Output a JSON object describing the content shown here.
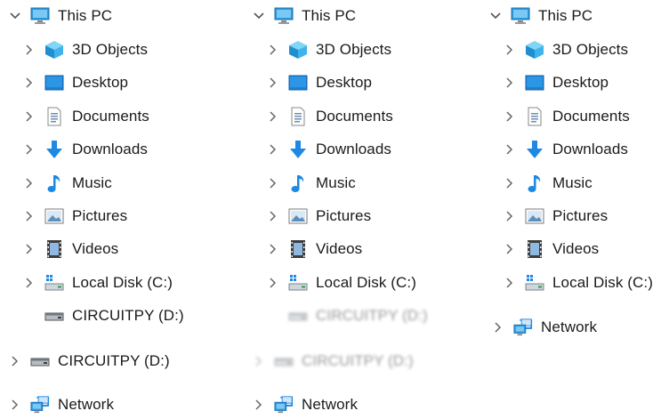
{
  "colors": {
    "chevron": "#555555",
    "text": "#1a1a1a",
    "accent_blue": "#1e88e5",
    "folder_blue": "#2a9be0"
  },
  "panes": [
    {
      "this_pc": {
        "label": "This PC",
        "icon": "this-pc-icon",
        "expanded": true
      },
      "items": [
        {
          "label": "3D Objects",
          "icon": "3d-objects-icon"
        },
        {
          "label": "Desktop",
          "icon": "desktop-icon"
        },
        {
          "label": "Documents",
          "icon": "documents-icon"
        },
        {
          "label": "Downloads",
          "icon": "downloads-icon"
        },
        {
          "label": "Music",
          "icon": "music-icon"
        },
        {
          "label": "Pictures",
          "icon": "pictures-icon"
        },
        {
          "label": "Videos",
          "icon": "videos-icon"
        },
        {
          "label": "Local Disk (C:)",
          "icon": "local-disk-icon"
        },
        {
          "label": "CIRCUITPY (D:)",
          "icon": "usb-drive-icon"
        }
      ],
      "root_items": [
        {
          "label": "CIRCUITPY (D:)",
          "icon": "usb-drive-icon"
        },
        {
          "label": "Network",
          "icon": "network-icon"
        }
      ]
    },
    {
      "this_pc": {
        "label": "This PC",
        "icon": "this-pc-icon",
        "expanded": true
      },
      "items": [
        {
          "label": "3D Objects",
          "icon": "3d-objects-icon"
        },
        {
          "label": "Desktop",
          "icon": "desktop-icon"
        },
        {
          "label": "Documents",
          "icon": "documents-icon"
        },
        {
          "label": "Downloads",
          "icon": "downloads-icon"
        },
        {
          "label": "Music",
          "icon": "music-icon"
        },
        {
          "label": "Pictures",
          "icon": "pictures-icon"
        },
        {
          "label": "Videos",
          "icon": "videos-icon"
        },
        {
          "label": "Local Disk (C:)",
          "icon": "local-disk-icon"
        },
        {
          "label": "CIRCUITPY (D:)",
          "icon": "usb-drive-icon",
          "faded": true
        }
      ],
      "root_items": [
        {
          "label": "CIRCUITPY (D:)",
          "icon": "usb-drive-icon",
          "faded": true
        },
        {
          "label": "Network",
          "icon": "network-icon"
        }
      ]
    },
    {
      "this_pc": {
        "label": "This PC",
        "icon": "this-pc-icon",
        "expanded": true
      },
      "items": [
        {
          "label": "3D Objects",
          "icon": "3d-objects-icon"
        },
        {
          "label": "Desktop",
          "icon": "desktop-icon"
        },
        {
          "label": "Documents",
          "icon": "documents-icon"
        },
        {
          "label": "Downloads",
          "icon": "downloads-icon"
        },
        {
          "label": "Music",
          "icon": "music-icon"
        },
        {
          "label": "Pictures",
          "icon": "pictures-icon"
        },
        {
          "label": "Videos",
          "icon": "videos-icon"
        },
        {
          "label": "Local Disk (C:)",
          "icon": "local-disk-icon"
        }
      ],
      "root_items": [
        {
          "label": "Network",
          "icon": "network-icon"
        }
      ]
    }
  ]
}
